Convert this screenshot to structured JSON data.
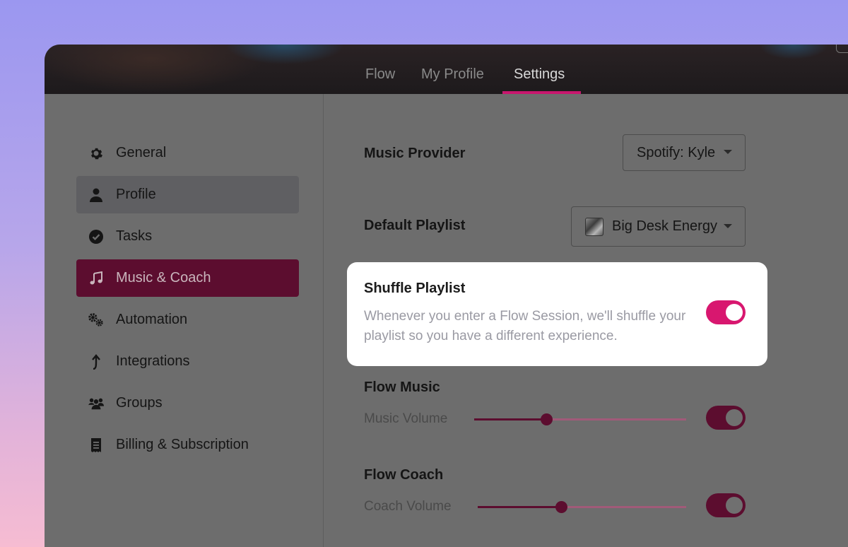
{
  "tabs": [
    {
      "label": "Flow"
    },
    {
      "label": "My Profile"
    },
    {
      "label": "Settings"
    }
  ],
  "sidebar": {
    "items": [
      {
        "label": "General",
        "icon": "gear-icon"
      },
      {
        "label": "Profile",
        "icon": "user-icon"
      },
      {
        "label": "Tasks",
        "icon": "check-circle-icon"
      },
      {
        "label": "Music & Coach",
        "icon": "music-note-icon"
      },
      {
        "label": "Automation",
        "icon": "gears-icon"
      },
      {
        "label": "Integrations",
        "icon": "arrow-up-icon"
      },
      {
        "label": "Groups",
        "icon": "users-icon"
      },
      {
        "label": "Billing & Subscription",
        "icon": "receipt-icon"
      }
    ]
  },
  "settings": {
    "music_provider": {
      "label": "Music Provider",
      "value": "Spotify: Kyle"
    },
    "default_playlist": {
      "label": "Default Playlist",
      "value": "Big Desk Energy"
    },
    "shuffle": {
      "title": "Shuffle Playlist",
      "description": "Whenever you enter a Flow Session, we'll shuffle your playlist so you have a different experience.",
      "enabled": true
    },
    "flow_music": {
      "title": "Flow Music",
      "slider_label": "Music Volume",
      "volume": 0.34,
      "enabled": true
    },
    "flow_coach": {
      "title": "Flow Coach",
      "slider_label": "Coach Volume",
      "volume": 0.4,
      "enabled": true
    }
  },
  "colors": {
    "accent": "#d8176f",
    "accent_dark": "#5c0d2f"
  }
}
